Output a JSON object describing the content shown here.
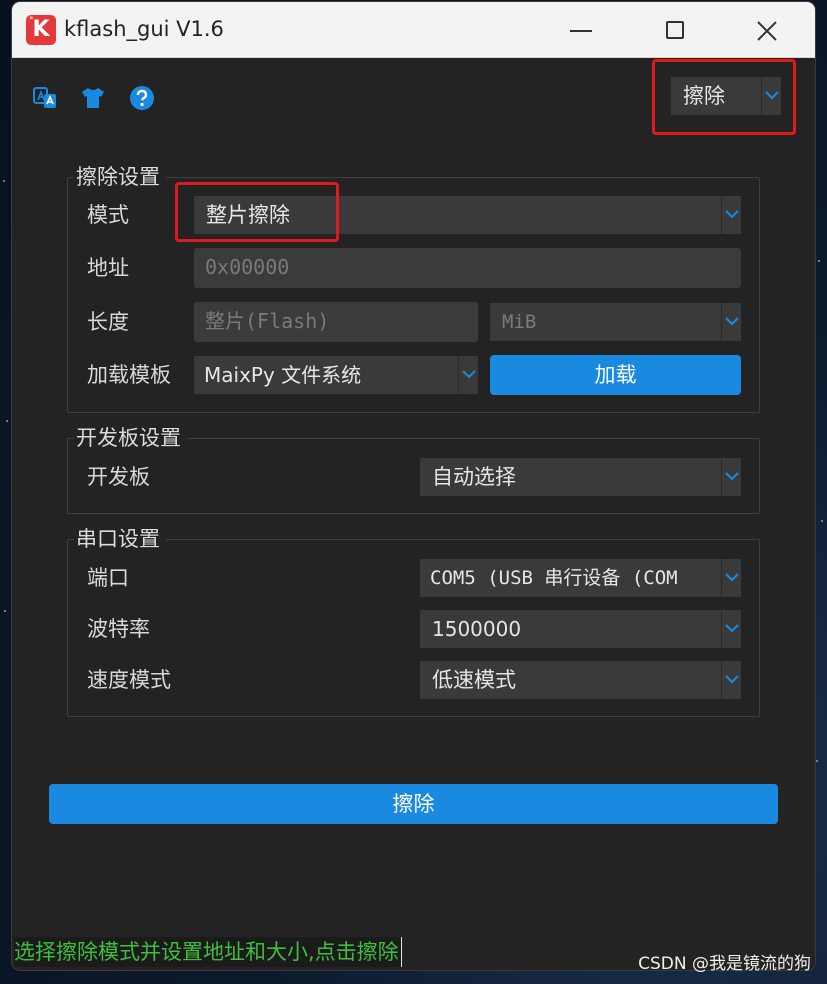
{
  "window": {
    "title": "kflash_gui V1.6",
    "logo_letter": "K"
  },
  "toolbar": {
    "icons": [
      "translate-icon",
      "shirt-icon",
      "help-icon"
    ],
    "mode_select": "擦除"
  },
  "erase_settings": {
    "title": "擦除设置",
    "mode_label": "模式",
    "mode_value": "整片擦除",
    "address_label": "地址",
    "address_value": "0x00000",
    "length_label": "长度",
    "length_value": "整片(Flash)",
    "unit_value": "MiB",
    "template_label": "加载模板",
    "template_value": "MaixPy 文件系统",
    "load_button": "加载"
  },
  "board_settings": {
    "title": "开发板设置",
    "board_label": "开发板",
    "board_value": "自动选择"
  },
  "serial_settings": {
    "title": "串口设置",
    "port_label": "端口",
    "port_value": "COM5 (USB 串行设备 (COM",
    "baud_label": "波特率",
    "baud_value": "1500000",
    "speed_label": "速度模式",
    "speed_value": "低速模式"
  },
  "actions": {
    "erase_button": "擦除"
  },
  "hint": "选择擦除模式并设置地址和大小,点击擦除",
  "watermark": "CSDN @我是镜流的狗",
  "colors": {
    "accent": "#1a8ae0",
    "annotation": "#e0191f",
    "hint_text": "#3fbf3f"
  }
}
